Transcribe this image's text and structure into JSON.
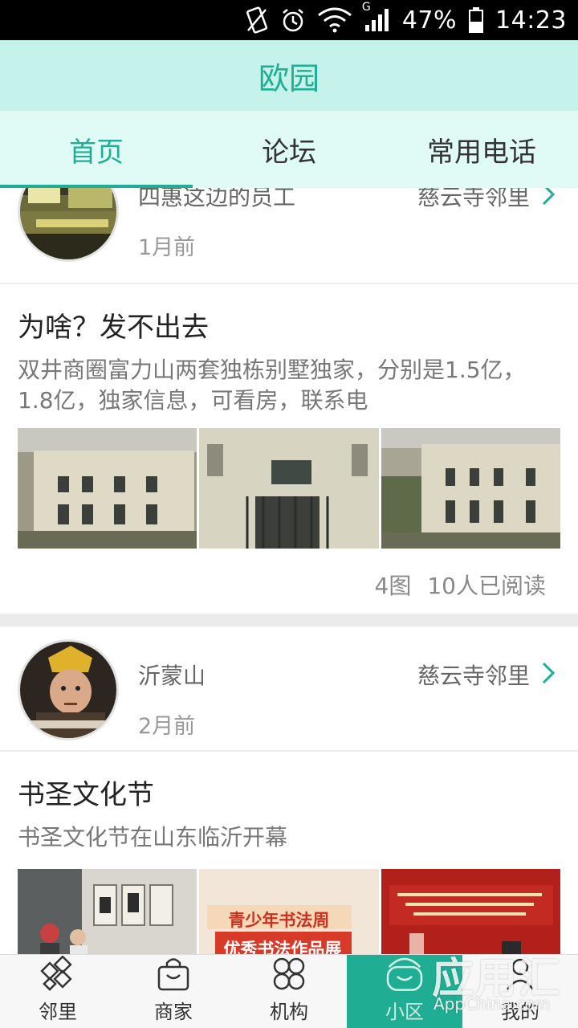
{
  "status_bar": {
    "network_type": "G",
    "battery": "47%",
    "time": "14:23"
  },
  "header": {
    "title": "欧园"
  },
  "tabs": [
    {
      "label": "首页",
      "active": true
    },
    {
      "label": "论坛",
      "active": false
    },
    {
      "label": "常用电话",
      "active": false
    }
  ],
  "posts": [
    {
      "author": "四惠这边的员工",
      "community": "慈云寺邻里",
      "time": "1月前",
      "title": "为啥？发不出去",
      "text": "双井商圈富力山两套独栋别墅独家，分别是1.5亿，1.8亿，独家信息，可看房，联系电",
      "image_count": "4图",
      "reads": "10人已阅读"
    },
    {
      "author": "沂蒙山",
      "community": "慈云寺邻里",
      "time": "2月前",
      "title": "书圣文化节",
      "text": "书圣文化节在山东临沂开幕",
      "banner_text_1": "青少年书法周",
      "banner_text_2": "优秀书法作品展"
    }
  ],
  "bottom_nav": [
    {
      "label": "邻里",
      "icon": "neighbors-icon",
      "active": false
    },
    {
      "label": "商家",
      "icon": "shopping-bag-icon",
      "active": false
    },
    {
      "label": "机构",
      "icon": "clover-grid-icon",
      "active": false
    },
    {
      "label": "小区",
      "icon": "community-bag-icon",
      "active": true
    },
    {
      "label": "我的",
      "icon": "person-icon",
      "active": false
    }
  ],
  "watermark": {
    "brand": "应用汇",
    "site": "AppChina.com"
  },
  "colors": {
    "accent": "#1fae94",
    "title_bar_bg": "#c5f2ea",
    "tab_bar_bg": "#e0fbf6"
  }
}
